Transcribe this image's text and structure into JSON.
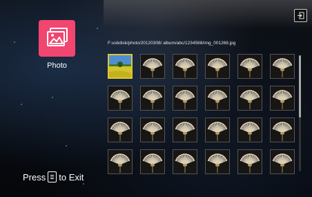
{
  "sidebar": {
    "tile_icon": "photo-icon",
    "tile_color": "#f1466f",
    "tile_label": "Photo"
  },
  "header": {
    "exit_icon": "exit-icon"
  },
  "browser": {
    "path": "F:usbdisk/photo/20120308/ album/abc/1234568/img_001268.jpg",
    "thumbnails": [
      {
        "kind": "landscape",
        "selected": true
      },
      {
        "kind": "dandelion"
      },
      {
        "kind": "dandelion"
      },
      {
        "kind": "dandelion"
      },
      {
        "kind": "dandelion"
      },
      {
        "kind": "dandelion"
      },
      {
        "kind": "dandelion"
      },
      {
        "kind": "dandelion"
      },
      {
        "kind": "dandelion"
      },
      {
        "kind": "dandelion"
      },
      {
        "kind": "dandelion"
      },
      {
        "kind": "dandelion"
      },
      {
        "kind": "dandelion"
      },
      {
        "kind": "dandelion"
      },
      {
        "kind": "dandelion"
      },
      {
        "kind": "dandelion"
      },
      {
        "kind": "dandelion"
      },
      {
        "kind": "dandelion"
      },
      {
        "kind": "dandelion"
      },
      {
        "kind": "dandelion"
      },
      {
        "kind": "dandelion"
      },
      {
        "kind": "dandelion"
      },
      {
        "kind": "dandelion"
      },
      {
        "kind": "dandelion"
      }
    ],
    "selection_color": "#e2c537"
  },
  "footer": {
    "press_text": "Press",
    "key_icon": "menu-key-icon",
    "exit_text": "to Exit"
  }
}
